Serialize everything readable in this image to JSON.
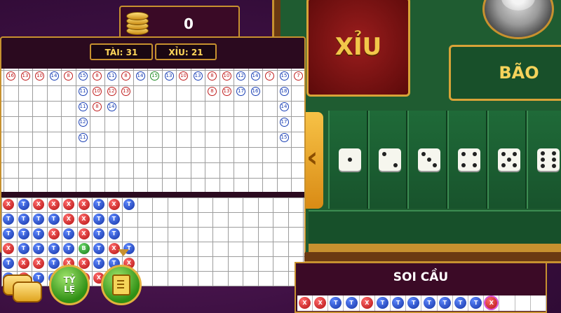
{
  "header": {
    "coin_value": "0"
  },
  "stats": {
    "tai_label": "TÀI: 31",
    "xiu_label": "XỈU: 21"
  },
  "table": {
    "xiu_label": "XỈU",
    "bao_label": "BÃO",
    "dice_faces": [
      1,
      2,
      3,
      4,
      5,
      6
    ]
  },
  "buttons": {
    "tyle_line1": "TỶ",
    "tyle_line2": "LỆ"
  },
  "soicau": {
    "title": "SOI CẦU",
    "results": [
      "X",
      "X",
      "T",
      "T",
      "X",
      "T",
      "T",
      "T",
      "T",
      "T",
      "T",
      "T",
      "X",
      "",
      "",
      ""
    ]
  },
  "history": {
    "sum_columns": [
      [
        {
          "v": "16",
          "c": "red"
        }
      ],
      [
        {
          "v": "13",
          "c": "red"
        }
      ],
      [
        {
          "v": "10",
          "c": "red"
        }
      ],
      [
        {
          "v": "14",
          "c": "blue"
        }
      ],
      [
        {
          "v": "8",
          "c": "red"
        }
      ],
      [
        {
          "v": "15",
          "c": "blue"
        },
        {
          "v": "11",
          "c": "blue"
        },
        {
          "v": "11",
          "c": "blue"
        },
        {
          "v": "12",
          "c": "blue"
        },
        {
          "v": "11",
          "c": "blue"
        }
      ],
      [
        {
          "v": "8",
          "c": "red"
        },
        {
          "v": "10",
          "c": "red"
        },
        {
          "v": "8",
          "c": "red"
        }
      ],
      [
        {
          "v": "11",
          "c": "blue"
        },
        {
          "v": "12",
          "c": "red"
        },
        {
          "v": "14",
          "c": "blue"
        }
      ],
      [
        {
          "v": "8",
          "c": "red"
        },
        {
          "v": "13",
          "c": "red"
        }
      ],
      [
        {
          "v": "14",
          "c": "blue"
        }
      ],
      [
        {
          "v": "15",
          "c": "green"
        }
      ],
      [
        {
          "v": "13",
          "c": "blue"
        }
      ],
      [
        {
          "v": "10",
          "c": "red"
        }
      ],
      [
        {
          "v": "13",
          "c": "blue"
        }
      ],
      [
        {
          "v": "8",
          "c": "red"
        },
        {
          "v": "8",
          "c": "red"
        }
      ],
      [
        {
          "v": "10",
          "c": "red"
        },
        {
          "v": "13",
          "c": "red"
        }
      ],
      [
        {
          "v": "12",
          "c": "blue"
        },
        {
          "v": "17",
          "c": "blue"
        }
      ],
      [
        {
          "v": "14",
          "c": "blue"
        },
        {
          "v": "16",
          "c": "blue"
        }
      ],
      [
        {
          "v": "7",
          "c": "red"
        }
      ],
      [
        {
          "v": "15",
          "c": "blue"
        },
        {
          "v": "18",
          "c": "blue"
        },
        {
          "v": "14",
          "c": "blue"
        },
        {
          "v": "17",
          "c": "blue"
        },
        {
          "v": "15",
          "c": "blue"
        }
      ],
      [
        {
          "v": "7",
          "c": "red"
        }
      ]
    ],
    "result_rows": [
      [
        "X",
        "T",
        "X",
        "X",
        "X",
        "X",
        "T",
        "X",
        "T"
      ],
      [
        "T",
        "T",
        "T",
        "T",
        "X",
        "X",
        "T",
        "T",
        ""
      ],
      [
        "T",
        "T",
        "T",
        "X",
        "T",
        "X",
        "T",
        "T",
        ""
      ],
      [
        "X",
        "T",
        "T",
        "T",
        "T",
        "B",
        "T",
        "X",
        "T"
      ],
      [
        "T",
        "X",
        "X",
        "T",
        "X",
        "X",
        "T",
        "T",
        "X"
      ],
      [
        "T",
        "X",
        "T",
        "T",
        "T",
        "X",
        "X",
        "T",
        ""
      ]
    ]
  }
}
